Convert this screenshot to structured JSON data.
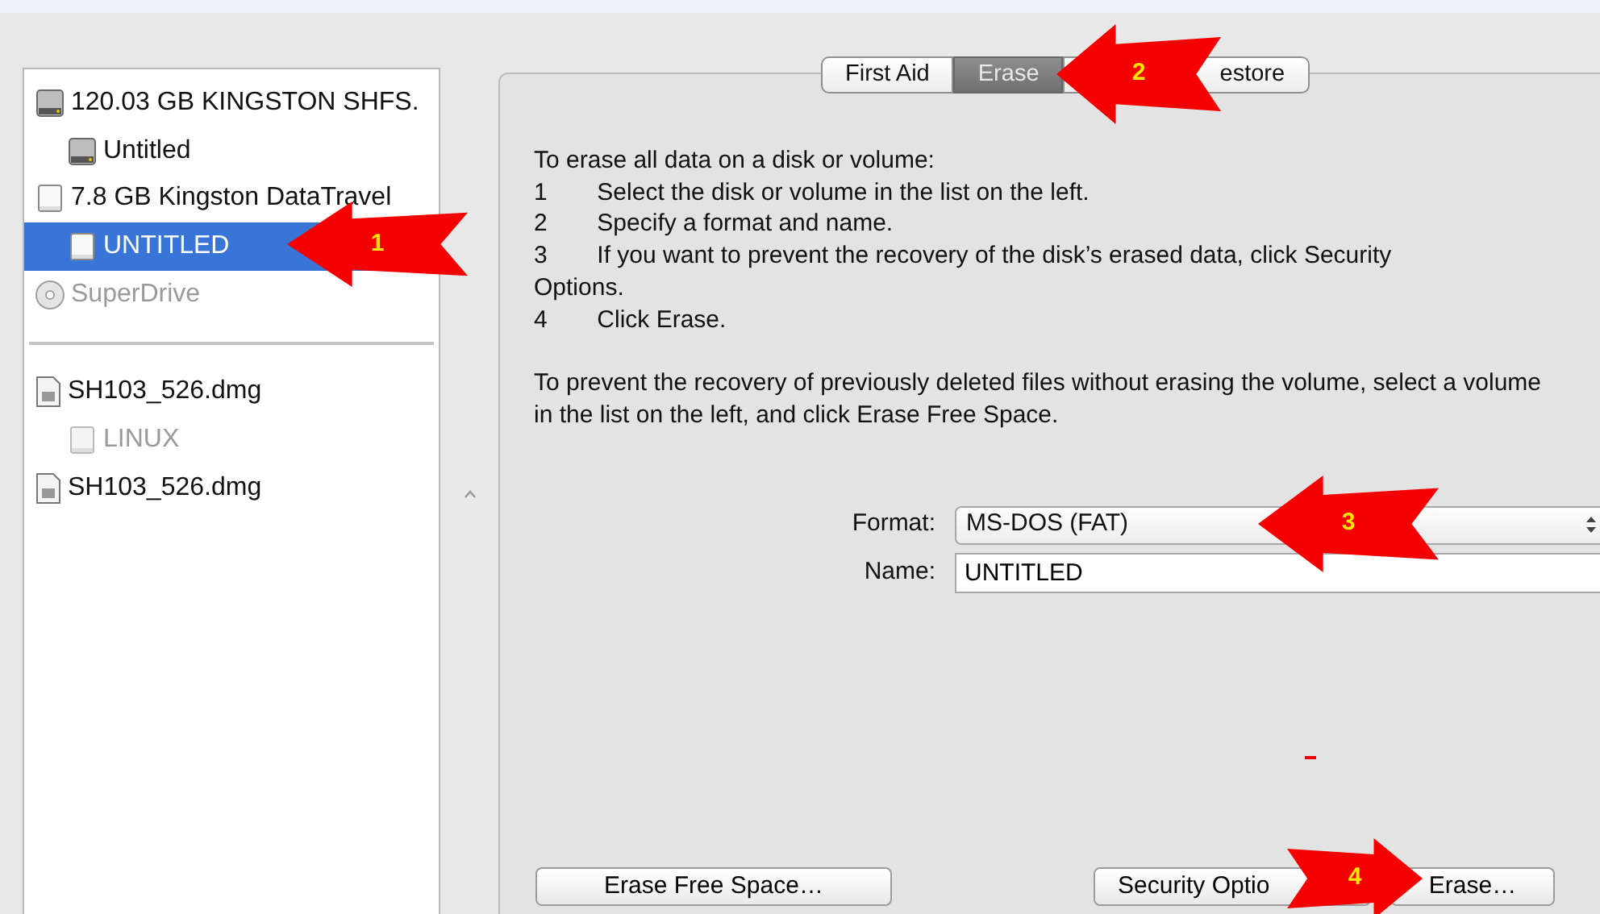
{
  "sidebar": {
    "items": [
      {
        "label": "120.03 GB KINGSTON SHFS.",
        "kind": "hdd",
        "selected": false,
        "disabled": false,
        "children": [
          {
            "label": "Untitled",
            "kind": "hdd",
            "selected": false,
            "disabled": false
          }
        ]
      },
      {
        "label": "7.8 GB Kingston DataTravel",
        "kind": "removable",
        "selected": false,
        "disabled": false,
        "children": [
          {
            "label": "UNTITLED",
            "kind": "removable",
            "selected": true,
            "disabled": false
          }
        ]
      },
      {
        "label": "SuperDrive",
        "kind": "optical",
        "selected": false,
        "disabled": true
      }
    ],
    "images": [
      {
        "label": "SH103_526.dmg",
        "kind": "image",
        "selected": false,
        "disabled": false,
        "children": [
          {
            "label": "LINUX",
            "kind": "removable",
            "selected": false,
            "disabled": true
          }
        ]
      },
      {
        "label": "SH103_526.dmg",
        "kind": "image",
        "selected": false,
        "disabled": false
      }
    ]
  },
  "tabs": [
    {
      "label": "First Aid",
      "selected": false
    },
    {
      "label": "Erase",
      "selected": true
    },
    {
      "label": "estore",
      "selected": false
    }
  ],
  "instructions": {
    "intro": "To erase all data on a disk or volume:",
    "steps": [
      {
        "number": "1",
        "text": "Select the disk or volume in the list on the left."
      },
      {
        "number": "2",
        "text": "Specify a format and name."
      },
      {
        "number": "3",
        "text": "If you want to prevent the recovery of the disk’s erased data, click Security Options."
      },
      {
        "number": "4",
        "text": "Click Erase."
      }
    ],
    "note": "To prevent the recovery of previously deleted files without erasing the volume, select a volume in the list on the left, and click Erase Free Space."
  },
  "format": {
    "label": "Format:",
    "value": "MS-DOS (FAT)"
  },
  "name": {
    "label": "Name:",
    "value": "UNTITLED"
  },
  "buttons": [
    {
      "label": "Erase Free Space…"
    },
    {
      "label": "Security Optio"
    },
    {
      "label": "Erase…"
    }
  ],
  "annotations": [
    {
      "number": "1",
      "kind": "left"
    },
    {
      "number": "2",
      "kind": "left"
    },
    {
      "number": "3",
      "kind": "left"
    },
    {
      "number": "4",
      "kind": "right"
    }
  ]
}
